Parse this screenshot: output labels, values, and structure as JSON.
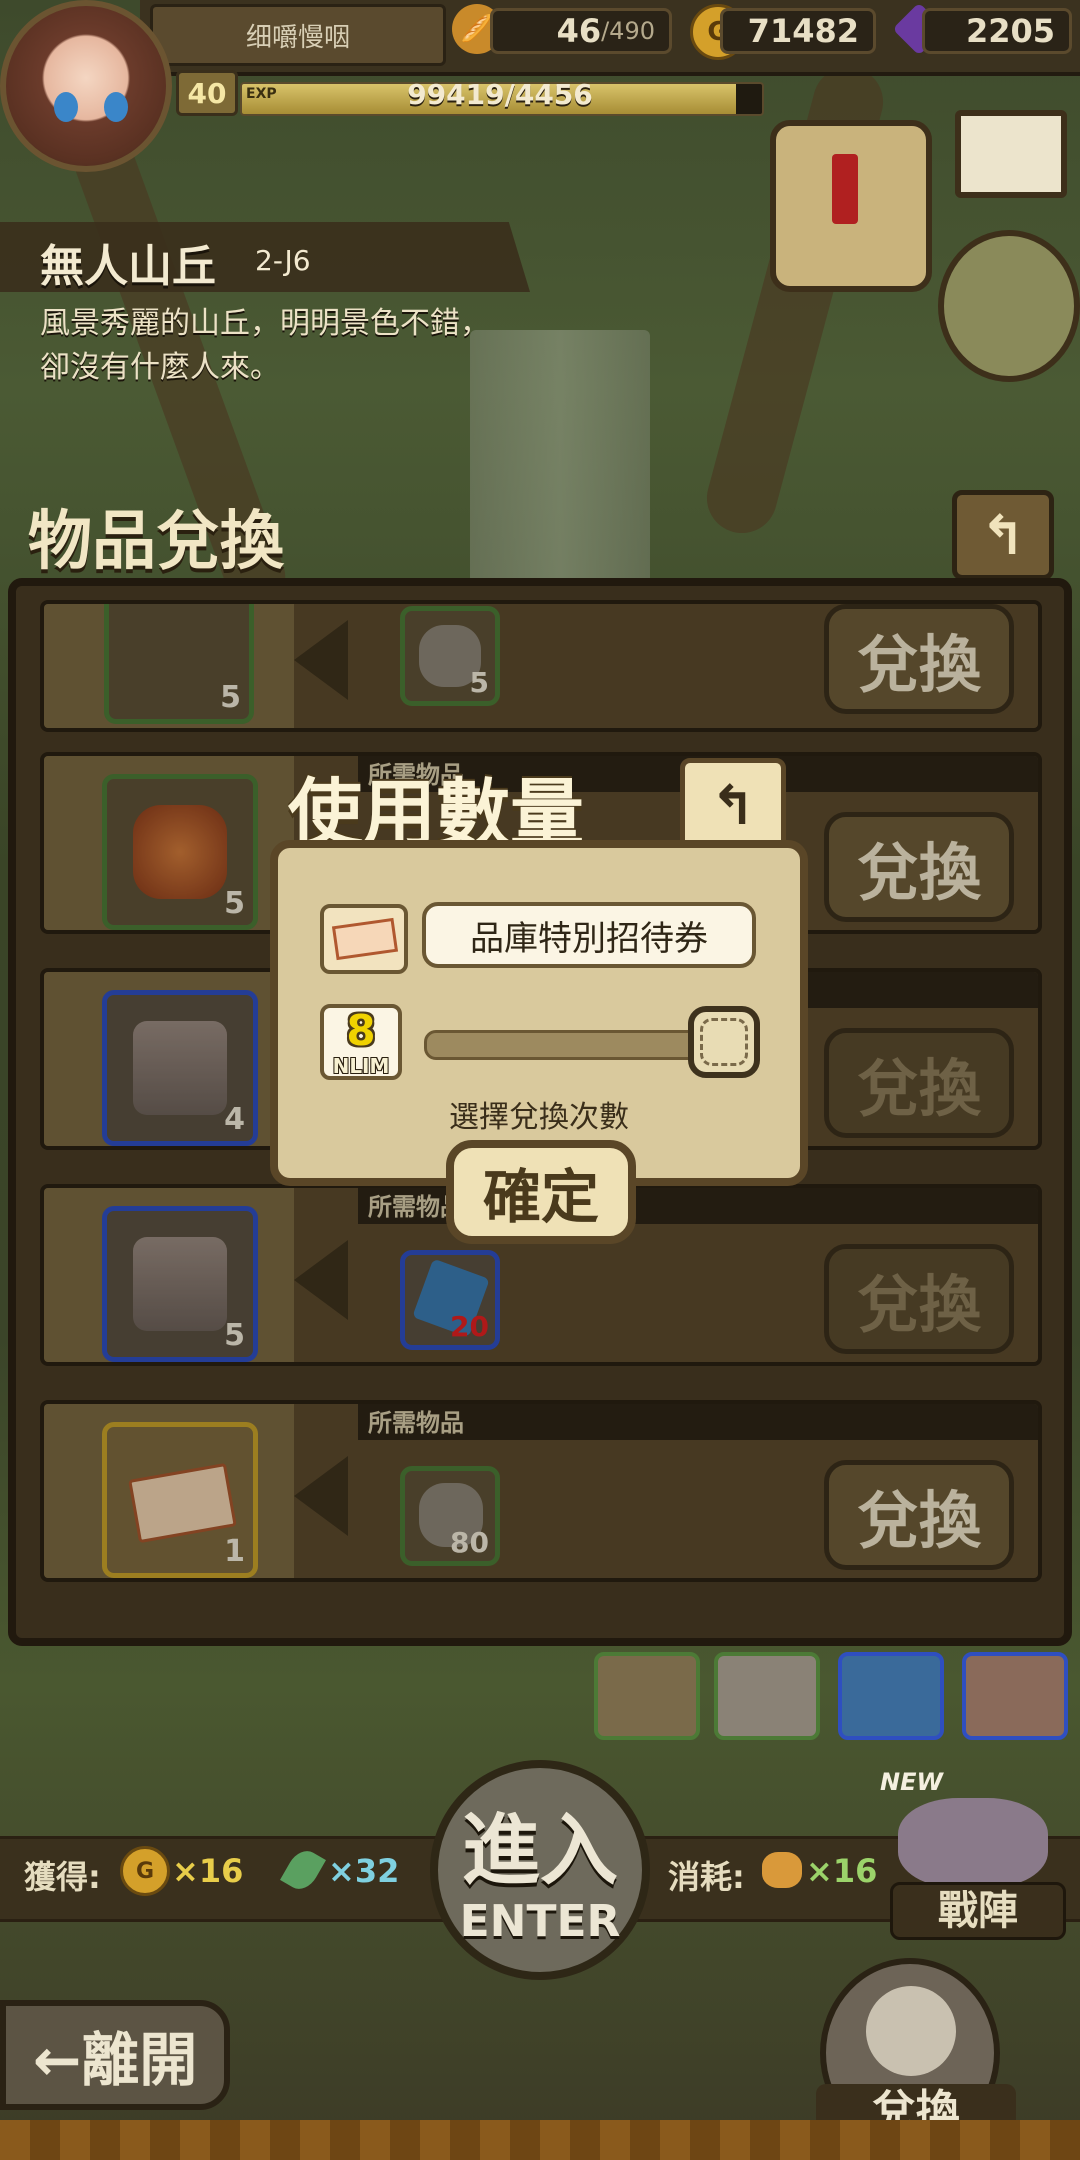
{
  "hud": {
    "player_name": "细嚼慢咽",
    "stamina": "46",
    "stamina_max": "/490",
    "gold": "71482",
    "gems": "2205",
    "level": "40",
    "exp_label": "EXP",
    "exp_value": "99419/4456",
    "exp_fill_fraction": 0.95
  },
  "location": {
    "name": "無人山丘",
    "code": "2-J6",
    "description_line1": "風景秀麗的山丘，明明景色不錯，",
    "description_line2": "卻沒有什麼人來。"
  },
  "panel": {
    "title": "物品兌換",
    "back_icon": "↰",
    "required_label": "所需物品",
    "rows": [
      {
        "item_icon": "trident-icon",
        "item_qty": "5",
        "req_icon": "ore-icon",
        "req_qty": "5",
        "button": "兌換",
        "enabled": true
      },
      {
        "item_icon": "wood-log-icon",
        "item_qty": "5",
        "req_icon": "ore-icon",
        "req_qty": "",
        "button": "兌換",
        "enabled": true
      },
      {
        "item_icon": "chest-icon",
        "item_qty": "4",
        "req_icon": "crystal-icon",
        "req_qty": "",
        "button": "兌換",
        "enabled": false
      },
      {
        "item_icon": "chest-icon",
        "item_qty": "5",
        "req_icon": "crystal-icon",
        "req_qty": "20",
        "button": "兌換",
        "enabled": false
      },
      {
        "item_icon": "ticket-icon",
        "item_qty": "1",
        "req_icon": "ore-icon",
        "req_qty": "80",
        "button": "兌換",
        "enabled": true
      }
    ]
  },
  "modal": {
    "title": "使用數量",
    "back_icon": "↰",
    "item_name": "品庫特別招待券",
    "count": "8",
    "count_label": "NLIM",
    "hint": "選擇兌換次數",
    "confirm": "確定",
    "slider_fraction": 1.0
  },
  "bottom": {
    "gain_label": "獲得:",
    "gain_gold": "×16",
    "gain_feather": "×32",
    "cost_label": "消耗:",
    "cost_bread": "×16",
    "enter_cn": "進入",
    "enter_en": "ENTER",
    "formation": "戰陣",
    "new_tag": "NEW",
    "leave": "←離開",
    "exchange": "兌換"
  },
  "colors": {
    "gold_value": "#e8cd4a",
    "feather_value": "#7fd0e0",
    "bread_value": "#9bd36a",
    "count_yellow": "#f0d200",
    "required_red": "#e02020"
  }
}
